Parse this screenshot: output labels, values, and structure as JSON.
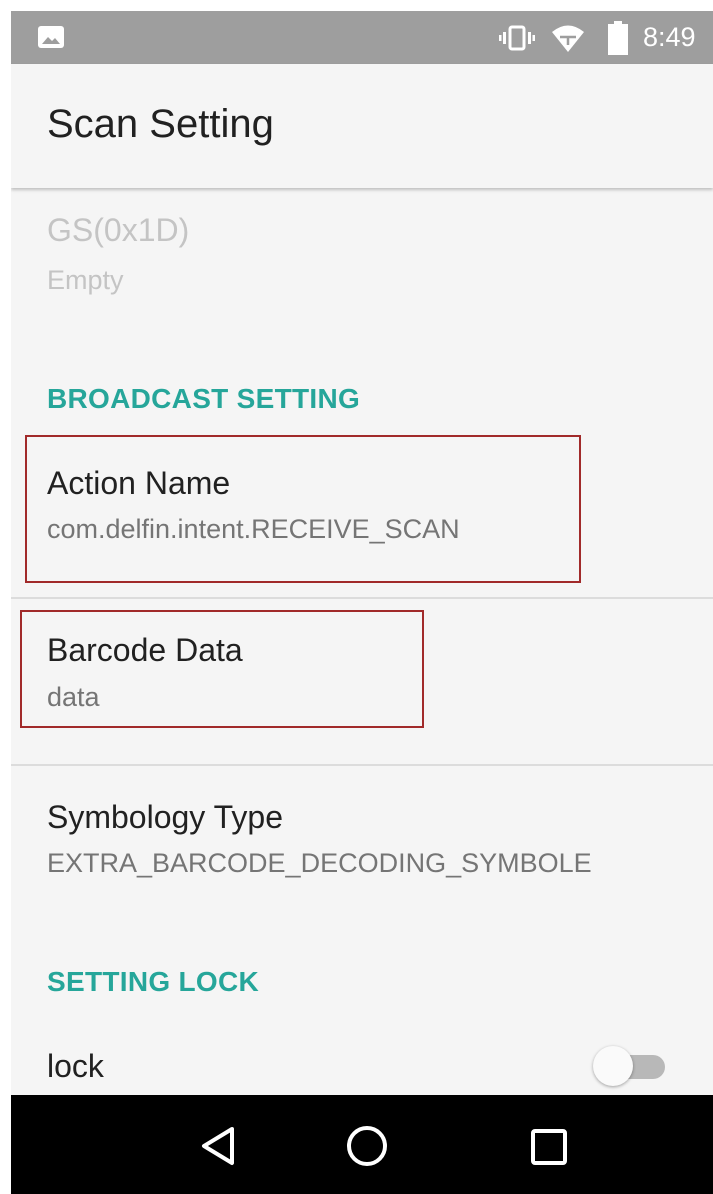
{
  "status_bar": {
    "time": "8:49",
    "icons": [
      "image-icon",
      "vibrate-icon",
      "wifi-icon",
      "battery-icon"
    ]
  },
  "app_bar": {
    "title": "Scan Setting"
  },
  "preferences": {
    "gs": {
      "title": "GS(0x1D)",
      "summary": "Empty",
      "enabled": false
    },
    "broadcast_category": "BROADCAST SETTING",
    "action_name": {
      "title": "Action Name",
      "summary": "com.delfin.intent.RECEIVE_SCAN"
    },
    "barcode_data": {
      "title": "Barcode Data",
      "summary": "data"
    },
    "symbology_type": {
      "title": "Symbology Type",
      "summary": "EXTRA_BARCODE_DECODING_SYMBOLE"
    },
    "lock_category": "SETTING LOCK",
    "lock": {
      "title": "lock",
      "checked": false
    }
  },
  "nav_bar": {
    "icons": [
      "back-icon",
      "home-icon",
      "recents-icon"
    ]
  },
  "colors": {
    "accent": "#26a69a",
    "highlight_border": "#a12a2a",
    "status_bar": "#9e9e9e",
    "nav_bar": "#000000"
  }
}
